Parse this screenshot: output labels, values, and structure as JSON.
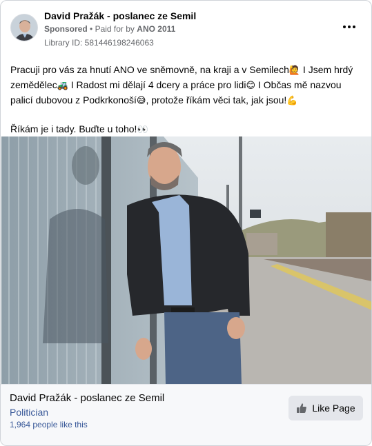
{
  "header": {
    "page_name": "David Pražák - poslanec ze Semil",
    "sponsored": "Sponsored",
    "separator": "•",
    "paid_prefix": "Paid for by",
    "payer": "ANO 2011",
    "library_id": "Library ID: 581446198246063"
  },
  "post": {
    "line1": "Pracuji pro vás za hnutí ANO ve sněmovně, na kraji a v Semilech",
    "line1_emoji": "🙋",
    "line1_after": " I Jsem hrdý",
    "line2a": "zemědělec",
    "line2_emoji1": "🚜",
    "line2b": " I Radost mi dělají 4 dcery a práce pro lidi",
    "line2_emoji2": "😊",
    "line2c": " I Občas mě nazvou",
    "line3a": "palicí dubovou z Podkrkonoší",
    "line3_emoji": "😅",
    "line3b": ", protože říkám věci tak, jak jsou!",
    "line3_emoji2": "💪",
    "line4": "Říkám je i tady. Buďte u toho!",
    "line4_emoji": "👀"
  },
  "footer": {
    "page_name": "David Pražák - poslanec ze Semil",
    "category": "Politician",
    "likes": "1,964 people like this",
    "like_button": "Like Page"
  },
  "icons": {
    "more": "more-options-icon",
    "like": "thumbs-up-icon"
  },
  "colors": {
    "link": "#385898",
    "meta": "#65676b",
    "button_bg": "#e4e6eb",
    "footer_bg": "#f7f8fa"
  }
}
